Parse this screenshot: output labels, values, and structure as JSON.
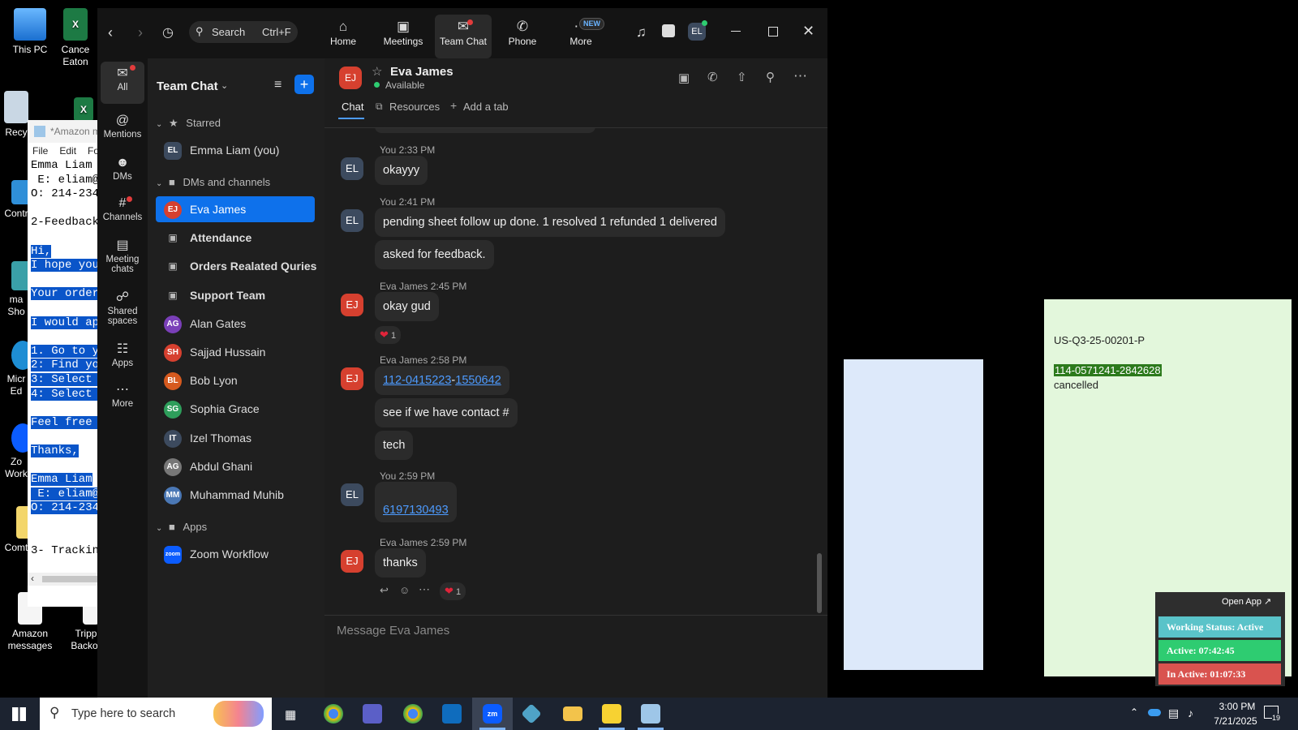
{
  "desktop": {
    "icons": [
      {
        "label": "This PC"
      },
      {
        "label": "Cance Eaton"
      },
      {
        "label": "Recy"
      },
      {
        "label": "Contr"
      },
      {
        "label": "ma Sho"
      },
      {
        "label": "Micr Ed"
      },
      {
        "label": "Zo Work"
      },
      {
        "label": "Comt"
      },
      {
        "label": "Amazon messages"
      },
      {
        "label": "Tripp Backor"
      }
    ]
  },
  "notepad": {
    "title": "*Amazon m",
    "menu": [
      "File",
      "Edit",
      "Fo"
    ],
    "lines": [
      {
        "text": "Emma Liam",
        "hl": false
      },
      {
        "text": " E: eliam@",
        "hl": false
      },
      {
        "text": "O: 214-234",
        "hl": false
      },
      {
        "text": "",
        "hl": false
      },
      {
        "text": "2-Feedback",
        "hl": false
      },
      {
        "text": "",
        "hl": false
      },
      {
        "text": "Hi,",
        "hl": true
      },
      {
        "text": "I hope you",
        "hl": true
      },
      {
        "text": "",
        "hl": false
      },
      {
        "text": "Your order",
        "hl": true
      },
      {
        "text": "",
        "hl": false
      },
      {
        "text": "I would ap",
        "hl": true
      },
      {
        "text": "",
        "hl": false
      },
      {
        "text": "1. Go to y",
        "hl": true
      },
      {
        "text": "2: Find yo",
        "hl": true
      },
      {
        "text": "3: Select ",
        "hl": true
      },
      {
        "text": "4: Select ",
        "hl": true
      },
      {
        "text": "",
        "hl": false
      },
      {
        "text": "Feel free ",
        "hl": true
      },
      {
        "text": "",
        "hl": false
      },
      {
        "text": "Thanks,",
        "hl": true
      },
      {
        "text": "",
        "hl": false
      },
      {
        "text": "Emma Liam",
        "hl": true
      },
      {
        "text": " E: eliam@",
        "hl": true
      },
      {
        "text": "O: 214-234",
        "hl": true
      },
      {
        "text": "",
        "hl": false
      },
      {
        "text": "",
        "hl": false
      },
      {
        "text": "3- Trackin",
        "hl": false
      }
    ]
  },
  "zoom": {
    "search": {
      "label": "Search",
      "shortcut": "Ctrl+F"
    },
    "nav": [
      {
        "label": "Home",
        "icon": "home-icon"
      },
      {
        "label": "Meetings",
        "icon": "video-icon"
      },
      {
        "label": "Team Chat",
        "icon": "chat-icon"
      },
      {
        "label": "Phone",
        "icon": "phone-icon"
      },
      {
        "label": "More",
        "icon": "more-icon",
        "badge": "NEW"
      }
    ],
    "user_initials": "EL",
    "rail": [
      {
        "label": "All",
        "icon": "chat-icon"
      },
      {
        "label": "Mentions",
        "icon": "at-icon"
      },
      {
        "label": "DMs",
        "icon": "people-icon"
      },
      {
        "label": "Channels",
        "icon": "hash-icon"
      },
      {
        "label": "Meeting chats",
        "icon": "calendar-icon"
      },
      {
        "label": "Shared spaces",
        "icon": "spaces-icon"
      },
      {
        "label": "Apps",
        "icon": "apps-icon"
      },
      {
        "label": "More",
        "icon": "ellipsis-icon"
      }
    ],
    "sidebar": {
      "title": "Team Chat",
      "starred_label": "Starred",
      "starred": [
        {
          "initials": "EL",
          "name": "Emma Liam (you)",
          "color": "#3c4a5e"
        }
      ],
      "dms_label": "DMs and channels",
      "items": [
        {
          "initials": "EJ",
          "name": "Eva James",
          "color": "#d6402f",
          "type": "dm",
          "active": true
        },
        {
          "name": "Attendance",
          "type": "channel"
        },
        {
          "name": "Orders Realated Quries",
          "type": "channel"
        },
        {
          "name": "Support Team",
          "type": "channel"
        },
        {
          "initials": "AG",
          "name": "Alan Gates",
          "color": "#7a3fb8",
          "type": "dm"
        },
        {
          "initials": "SH",
          "name": "Sajjad Hussain",
          "color": "#d6402f",
          "type": "dm"
        },
        {
          "initials": "BL",
          "name": "Bob Lyon",
          "color": "#d65a1f",
          "type": "dm"
        },
        {
          "initials": "SG",
          "name": "Sophia Grace",
          "color": "#2e9e5b",
          "type": "dm"
        },
        {
          "initials": "IT",
          "name": "Izel Thomas",
          "color": "#3c4a5e",
          "type": "dm"
        },
        {
          "initials": "AG",
          "name": "Abdul Ghani",
          "color": "#777777",
          "type": "dm"
        },
        {
          "initials": "MM",
          "name": "Muhammad Muhib",
          "color": "#4b78b5",
          "type": "dm"
        }
      ],
      "apps_label": "Apps",
      "apps": [
        {
          "name": "Zoom Workflow",
          "initials": "zoom",
          "color": "#0b5cff"
        }
      ]
    },
    "chat": {
      "contact": "Eva James",
      "contact_initials": "EJ",
      "status": "Available",
      "tabs": [
        "Chat",
        "Resources",
        "Add a tab"
      ],
      "messages": [
        {
          "meta": "You 2:33 PM",
          "initials": "EL",
          "bubbles": [
            "okayyy"
          ]
        },
        {
          "meta": "You 2:41 PM",
          "initials": "EL",
          "bubbles": [
            "pending sheet follow up done. 1 resolved 1 refunded 1 delivered",
            "asked for feedback."
          ]
        },
        {
          "meta": "Eva James 2:45 PM",
          "initials": "EJ",
          "bubbles": [
            "okay gud"
          ],
          "reaction": "1"
        },
        {
          "meta": "Eva James 2:58 PM",
          "initials": "EJ",
          "link1": "112-0415223",
          "sep": "-",
          "link2": "1550642",
          "bubbles": [
            "see if we have contact #",
            "tech"
          ]
        },
        {
          "meta": "You 2:59 PM",
          "initials": "EL",
          "link": "6197130493"
        },
        {
          "meta": "Eva James 2:59 PM",
          "initials": "EJ",
          "bubbles": [
            "thanks"
          ],
          "reaction": "1"
        }
      ],
      "composer_placeholder": "Message Eva James"
    }
  },
  "sticky": {
    "line1": "US-Q3-25-00201-P",
    "line2": "114-0571241-2842628",
    "line3": "cancelled"
  },
  "widget": {
    "open_app": "Open App ↗",
    "working": "Working Status: Active",
    "active": "Active: 07:42:45",
    "inactive": "In Active: 01:07:33"
  },
  "taskbar": {
    "search_placeholder": "Type here to search",
    "time": "3:00 PM",
    "date": "7/21/2025",
    "notif_count": "19"
  }
}
